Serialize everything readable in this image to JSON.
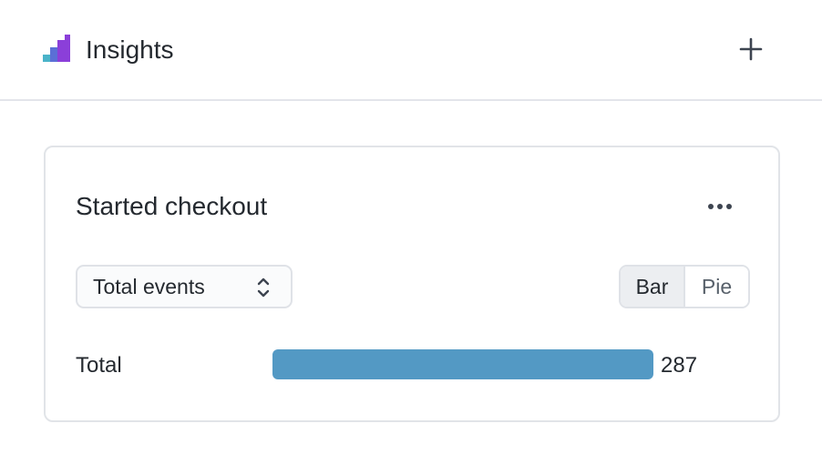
{
  "header": {
    "title": "Insights",
    "logo_icon": "bar-chart-logo-icon",
    "add_icon": "plus-icon"
  },
  "card": {
    "title": "Started checkout",
    "more_icon": "more-horizontal-icon",
    "metric_select": {
      "value": "Total events",
      "icon": "chevron-up-down-icon"
    },
    "view_toggle": {
      "options": [
        "Bar",
        "Pie"
      ],
      "selected": "Bar"
    },
    "rows": [
      {
        "label": "Total",
        "value": "287",
        "fraction": 1.0
      }
    ]
  },
  "colors": {
    "bar": "#5399c4",
    "logo_teal": "#4ab3c9",
    "logo_blue": "#5b6fd6",
    "logo_purple": "#8b3fd9"
  }
}
